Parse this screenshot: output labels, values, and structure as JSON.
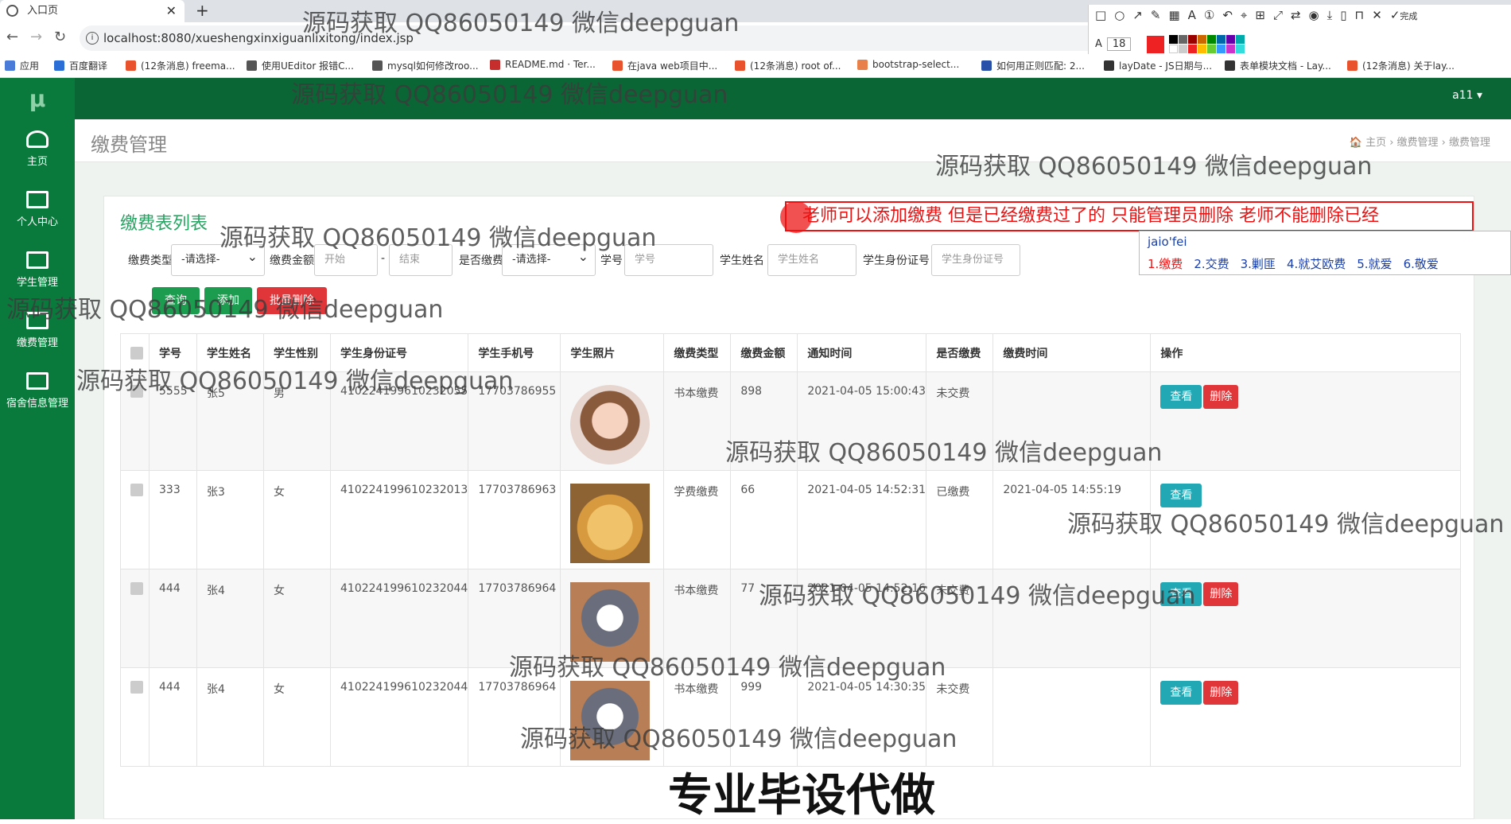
{
  "browser": {
    "tab_title": "入口页",
    "url": "localhost:8080/xueshengxinxiguanlixitong/index.jsp",
    "bookmarks": [
      "应用",
      "百度翻译",
      "(12条消息) freema...",
      "使用UEditor 报错C...",
      "mysql如何修改roo...",
      "README.md · Ter...",
      "在java web项目中...",
      "(12条消息) root of...",
      "bootstrap-select...",
      "如何用正则匹配: 2...",
      "layDate - JS日期与...",
      "表单模块文档 - Lay...",
      "(12条消息) 关于lay..."
    ],
    "annot_font_size": "18",
    "annot_done": "完成"
  },
  "sidebar": {
    "logo": "μ",
    "items": [
      "主页",
      "个人中心",
      "学生管理",
      "缴费管理",
      "宿舍信息管理"
    ]
  },
  "topbar": {
    "user": "a11 ▾"
  },
  "page": {
    "title": "缴费管理",
    "breadcrumb": "🏠 主页  ›  缴费管理  ›  缴费管理"
  },
  "panel": {
    "title": "缴费表列表"
  },
  "notice": "老师可以添加缴费 但是已经缴费过了的 只能管理员删除 老师不能删除已经",
  "ime": {
    "pinyin": "jaio'fei",
    "candidates": [
      "1.缴费",
      "2.交费",
      "3.剿匪",
      "4.就艾欧费",
      "5.就爱",
      "6.敬爱"
    ]
  },
  "filters": {
    "type_label": "缴费类型",
    "type_value": "-请选择-",
    "amount_label": "缴费金额",
    "amount_start": "开始",
    "amount_sep": "-",
    "amount_end": "结束",
    "paid_label": "是否缴费",
    "paid_value": "-请选择-",
    "no_label": "学号",
    "no_placeholder": "学号",
    "name_label": "学生姓名",
    "name_placeholder": "学生姓名",
    "id_label": "学生身份证号",
    "id_placeholder": "学生身份证号"
  },
  "buttons": {
    "query": "查询",
    "add": "添加",
    "batch_delete": "批量删除"
  },
  "table": {
    "headers": [
      "学号",
      "学生姓名",
      "学生性别",
      "学生身份证号",
      "学生手机号",
      "学生照片",
      "缴费类型",
      "缴费金额",
      "通知时间",
      "是否缴费",
      "缴费时间",
      "操作"
    ],
    "rows": [
      {
        "no": "5555",
        "name": "张5",
        "gender": "男",
        "id": "410224199610232055",
        "phone": "17703786955",
        "type": "书本缴费",
        "amount": "898",
        "notice_time": "2021-04-05 15:00:43",
        "paid": "未交费",
        "pay_time": ""
      },
      {
        "no": "333",
        "name": "张3",
        "gender": "女",
        "id": "410224199610232013",
        "phone": "17703786963",
        "type": "学费缴费",
        "amount": "66",
        "notice_time": "2021-04-05 14:52:31",
        "paid": "已缴费",
        "pay_time": "2021-04-05 14:55:19"
      },
      {
        "no": "444",
        "name": "张4",
        "gender": "女",
        "id": "410224199610232044",
        "phone": "17703786964",
        "type": "书本缴费",
        "amount": "77",
        "notice_time": "2021-04-05 14:52:16",
        "paid": "未交费",
        "pay_time": ""
      },
      {
        "no": "444",
        "name": "张4",
        "gender": "女",
        "id": "410224199610232044",
        "phone": "17703786964",
        "type": "书本缴费",
        "amount": "999",
        "notice_time": "2021-04-05 14:30:35",
        "paid": "未交费",
        "pay_time": ""
      }
    ],
    "view_label": "查看",
    "delete_label": "删除"
  },
  "watermarks": [
    "源码获取 QQ86050149 微信deepguan",
    "专业毕设代做"
  ]
}
